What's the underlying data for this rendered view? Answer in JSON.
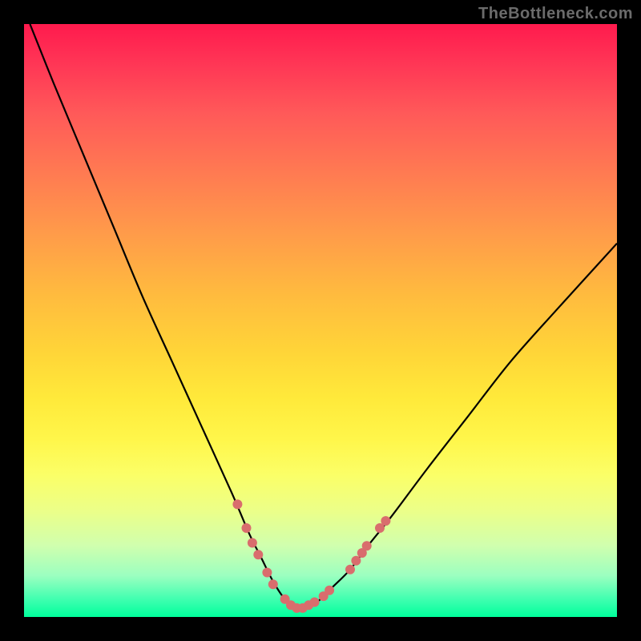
{
  "watermark": "TheBottleneck.com",
  "chart_data": {
    "type": "line",
    "title": "",
    "xlabel": "",
    "ylabel": "",
    "xlim": [
      0,
      100
    ],
    "ylim": [
      0,
      100
    ],
    "background_gradient": {
      "top_color": "#ff1a4d",
      "bottom_color": "#00ff9c",
      "meaning": "vertical gradient from red (high/bad) through orange/yellow to green (low/good)"
    },
    "series": [
      {
        "name": "bottleneck-curve",
        "description": "V-shaped curve; left branch steeper than right; minimum near x≈45",
        "color": "#000000",
        "x": [
          1,
          5,
          10,
          15,
          20,
          25,
          30,
          35,
          38,
          40,
          42,
          44,
          46,
          48,
          50,
          52,
          55,
          58,
          62,
          68,
          75,
          82,
          90,
          100
        ],
        "y": [
          100,
          90,
          78,
          66,
          54,
          43,
          32,
          21,
          14,
          10,
          6,
          3,
          1.5,
          1.5,
          3,
          5,
          8,
          12,
          17,
          25,
          34,
          43,
          52,
          63
        ]
      }
    ],
    "markers": {
      "name": "highlight-dots",
      "color": "#d96d6d",
      "radius": 6,
      "points": [
        {
          "x": 36,
          "y": 19
        },
        {
          "x": 37.5,
          "y": 15
        },
        {
          "x": 38.5,
          "y": 12.5
        },
        {
          "x": 39.5,
          "y": 10.5
        },
        {
          "x": 41,
          "y": 7.5
        },
        {
          "x": 42,
          "y": 5.5
        },
        {
          "x": 44,
          "y": 3
        },
        {
          "x": 45,
          "y": 2
        },
        {
          "x": 46,
          "y": 1.5
        },
        {
          "x": 47,
          "y": 1.5
        },
        {
          "x": 48,
          "y": 2
        },
        {
          "x": 49,
          "y": 2.5
        },
        {
          "x": 50.5,
          "y": 3.5
        },
        {
          "x": 51.5,
          "y": 4.5
        },
        {
          "x": 55,
          "y": 8
        },
        {
          "x": 56,
          "y": 9.5
        },
        {
          "x": 57,
          "y": 10.8
        },
        {
          "x": 57.8,
          "y": 12
        },
        {
          "x": 60,
          "y": 15
        },
        {
          "x": 61,
          "y": 16.2
        }
      ]
    }
  }
}
